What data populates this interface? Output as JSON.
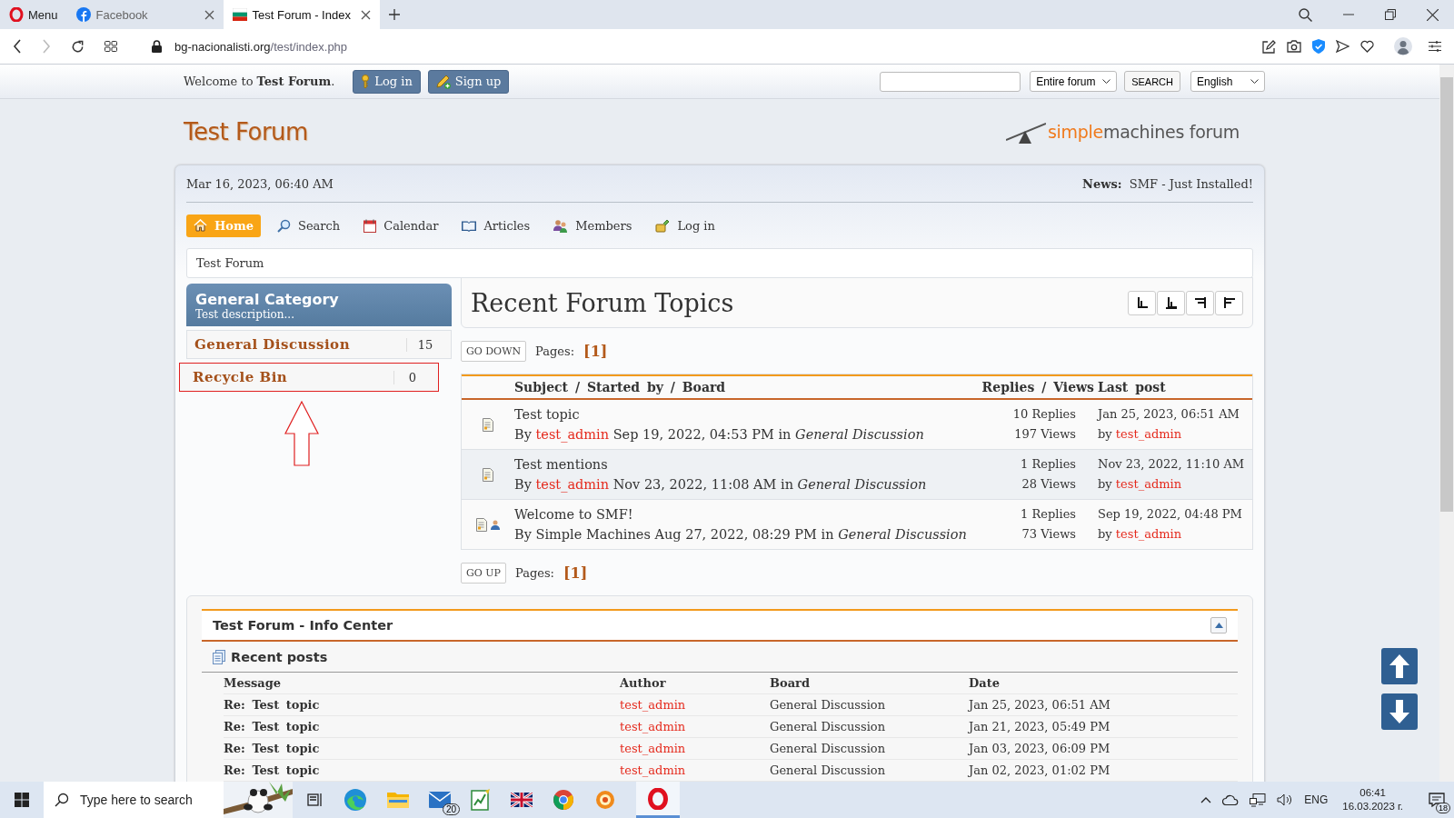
{
  "browser": {
    "tabs": [
      {
        "kind": "menu",
        "label": "Menu",
        "selected": false
      },
      {
        "kind": "facebook",
        "label": "Facebook",
        "selected": false
      },
      {
        "kind": "flag",
        "label": "Test Forum - Index",
        "selected": true
      }
    ],
    "address": {
      "domain": "bg-nacionalisti.org",
      "path": "/test/index.php"
    }
  },
  "user_bar": {
    "welcome": "Welcome to **Test Forum**.",
    "buttons": [
      "Log in",
      "Sign up"
    ],
    "search_scope": "Entire forum",
    "search_button": "SEARCH",
    "language": "English"
  },
  "header": {
    "title": "Test Forum",
    "logo": {
      "accent": "simple",
      "main": "machines",
      "suffix": "forum"
    }
  },
  "info_bar": {
    "date": "Mar 16, 2023, 06:40 AM",
    "news_label": "News:",
    "news": "SMF - Just Installed!"
  },
  "nav": [
    {
      "label": "Home",
      "selected": true
    },
    {
      "label": "Search",
      "selected": false
    },
    {
      "label": "Calendar",
      "selected": false
    },
    {
      "label": "Articles",
      "selected": false
    },
    {
      "label": "Members",
      "selected": false
    },
    {
      "label": "Log in",
      "selected": false
    }
  ],
  "breadcrumb": "Test Forum",
  "sidebar": {
    "category": "General Category",
    "description": "Test description...",
    "arrow_annotation": true,
    "boards": [
      {
        "name": "General Discussion",
        "count": "15",
        "highlighted": false
      },
      {
        "name": "Recycle Bin",
        "count": "0",
        "highlighted": true
      }
    ]
  },
  "topics": {
    "title": "Recent Forum Topics",
    "go_down": "GO DOWN",
    "go_up": "GO UP",
    "pages_top": {
      "label": "Pages:",
      "page": "[1]"
    },
    "pages_bottom": {
      "label": "Pages:",
      "page": "[1]"
    },
    "headers": {
      "subject": "Subject / Started by / Board",
      "stats": "Replies / Views",
      "last": "Last post"
    },
    "rows": [
      {
        "subject": "Test topic",
        "by": "By",
        "author": "test_admin",
        "author_linked": true,
        "posted": "Sep 19, 2022, 04:53 PM in",
        "board": "General Discussion",
        "replies": "10 Replies",
        "views": "197 Views",
        "last_date": "Jan 25, 2023, 06:51 AM",
        "last_by": "by",
        "last_author": "test_admin",
        "starter_icon": false
      },
      {
        "subject": "Test mentions",
        "by": "By",
        "author": "test_admin",
        "author_linked": true,
        "posted": "Nov 23, 2022, 11:08 AM in",
        "board": "General Discussion",
        "replies": "1 Replies",
        "views": "28 Views",
        "last_date": "Nov 23, 2022, 11:10 AM",
        "last_by": "by",
        "last_author": "test_admin",
        "starter_icon": false
      },
      {
        "subject": "Welcome to SMF!",
        "by": "By",
        "author": "Simple Machines",
        "author_linked": false,
        "posted": "Aug 27, 2022, 08:29 PM in",
        "board": "General Discussion",
        "replies": "1 Replies",
        "views": "73 Views",
        "last_date": "Sep 19, 2022, 04:48 PM",
        "last_by": "by",
        "last_author": "test_admin",
        "starter_icon": true
      }
    ]
  },
  "info_center": {
    "title": "Test Forum - Info Center",
    "section": "Recent posts",
    "columns": [
      "Message",
      "Author",
      "Board",
      "Date"
    ],
    "rows": [
      {
        "message": "Re: Test topic",
        "author": "test_admin",
        "board": "General Discussion",
        "date": "Jan 25, 2023, 06:51 AM"
      },
      {
        "message": "Re: Test topic",
        "author": "test_admin",
        "board": "General Discussion",
        "date": "Jan 21, 2023, 05:49 PM"
      },
      {
        "message": "Re: Test topic",
        "author": "test_admin",
        "board": "General Discussion",
        "date": "Jan 03, 2023, 06:09 PM"
      },
      {
        "message": "Re: Test topic",
        "author": "test_admin",
        "board": "General Discussion",
        "date": "Jan 02, 2023, 01:02 PM"
      }
    ]
  },
  "taskbar": {
    "search_placeholder": "Type here to search",
    "mail_badge": "20",
    "language": "ENG",
    "time": "06:41",
    "date": "16.03.2023 г.",
    "notification_count": "18"
  }
}
